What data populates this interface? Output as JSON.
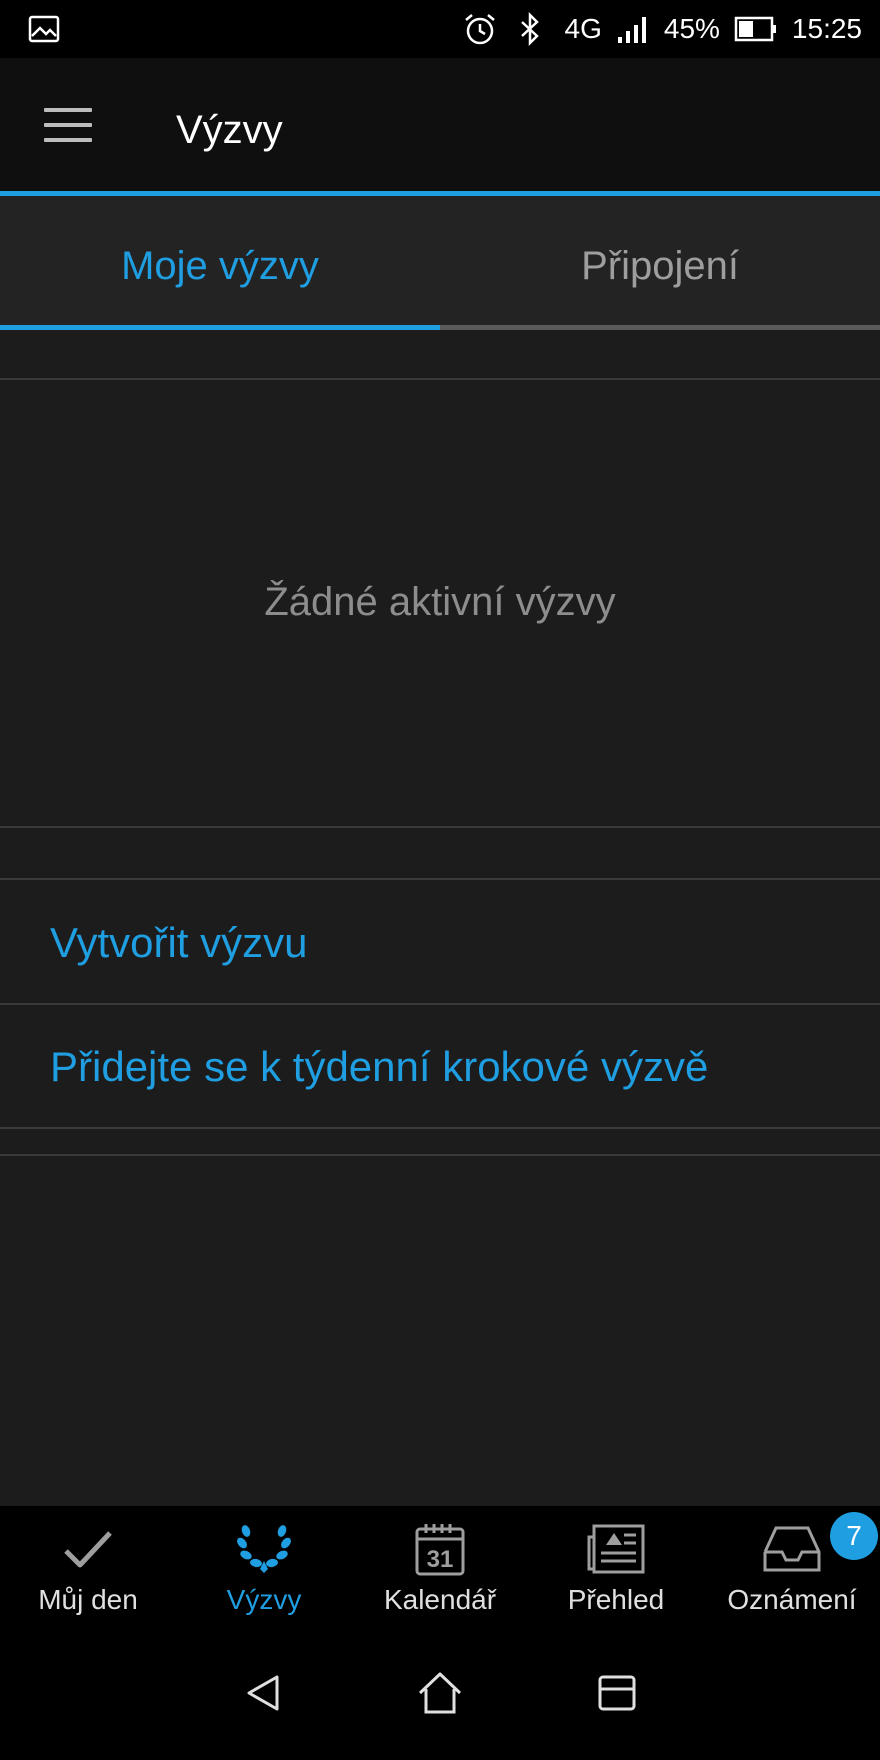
{
  "status_bar": {
    "network": "4G",
    "battery": "45%",
    "time": "15:25",
    "icons": [
      "image-icon",
      "alarm-icon",
      "bluetooth-icon",
      "signal-icon",
      "battery-icon"
    ]
  },
  "app_bar": {
    "title": "Výzvy",
    "menu_icon": "hamburger-menu-icon"
  },
  "tabs": [
    {
      "label": "Moje výzvy",
      "active": true
    },
    {
      "label": "Připojení",
      "active": false
    }
  ],
  "main": {
    "empty_message": "Žádné aktivní výzvy",
    "actions": [
      {
        "label": "Vytvořit výzvu"
      },
      {
        "label": "Přidejte se k týdenní krokové výzvě"
      }
    ]
  },
  "bottom_nav": {
    "items": [
      {
        "label": "Můj den",
        "icon": "checkmark-icon",
        "active": false
      },
      {
        "label": "Výzvy",
        "icon": "laurel-icon",
        "active": true
      },
      {
        "label": "Kalendář",
        "icon": "calendar-icon",
        "calendar_day": "31",
        "active": false
      },
      {
        "label": "Přehled",
        "icon": "newsfeed-icon",
        "active": false
      },
      {
        "label": "Oznámení",
        "icon": "inbox-icon",
        "badge": "7",
        "active": false
      }
    ]
  },
  "system_nav": {
    "icons": [
      "back-icon",
      "home-icon",
      "recents-icon"
    ]
  },
  "colors": {
    "accent": "#1f9ee1",
    "background": "#1c1c1c",
    "bar": "#000000"
  }
}
